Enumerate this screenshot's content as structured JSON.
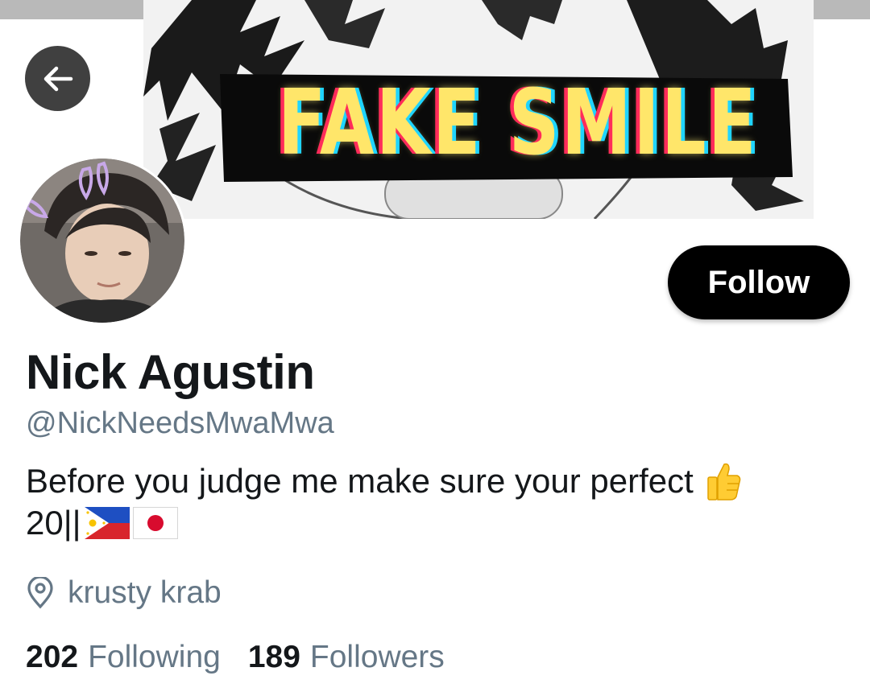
{
  "header": {
    "banner_text": "FAKE SMILE",
    "back_icon": "arrow-left-icon"
  },
  "profile": {
    "name": "Nick Agustin",
    "handle": "@NickNeedsMwaMwa",
    "follow_label": "Follow",
    "bio_line1": "Before you judge me make sure your perfect",
    "bio_line2": "20||",
    "bio_emojis": [
      "thumbs-up-icon",
      "philippines-flag-icon",
      "japan-flag-icon"
    ],
    "location": "krusty krab",
    "location_icon": "location-pin-icon"
  },
  "stats": {
    "following_count": "202",
    "following_label": "Following",
    "followers_count": "189",
    "followers_label": "Followers"
  },
  "colors": {
    "follow_bg": "#000000",
    "text_primary": "#14171a",
    "text_secondary": "#657786",
    "back_button_bg": "#404040"
  }
}
